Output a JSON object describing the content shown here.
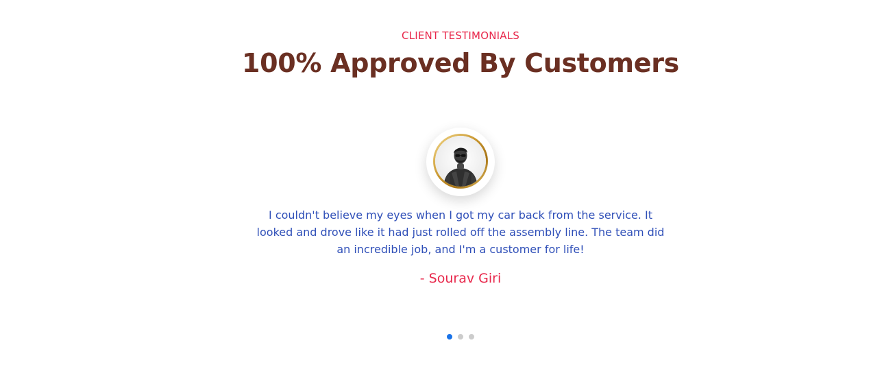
{
  "testimonials": {
    "eyebrow": "CLIENT TESTIMONIALS",
    "headline": "100% Approved By Customers",
    "quote": "I couldn't believe my eyes when I got my car back from the service. It looked and drove like it had just rolled off the assembly line. The team did an incredible job, and I'm a customer for life!",
    "author": "- Sourav Giri",
    "dots": [
      {
        "active": true
      },
      {
        "active": false
      },
      {
        "active": false
      }
    ]
  },
  "colors": {
    "accent": "#e8274b",
    "heading": "#6a2f22",
    "quote_text": "#2f4fb8",
    "dot_active": "#1a73e8",
    "dot_inactive": "#cccccc"
  },
  "icons": {
    "avatar": "customer-photo"
  }
}
